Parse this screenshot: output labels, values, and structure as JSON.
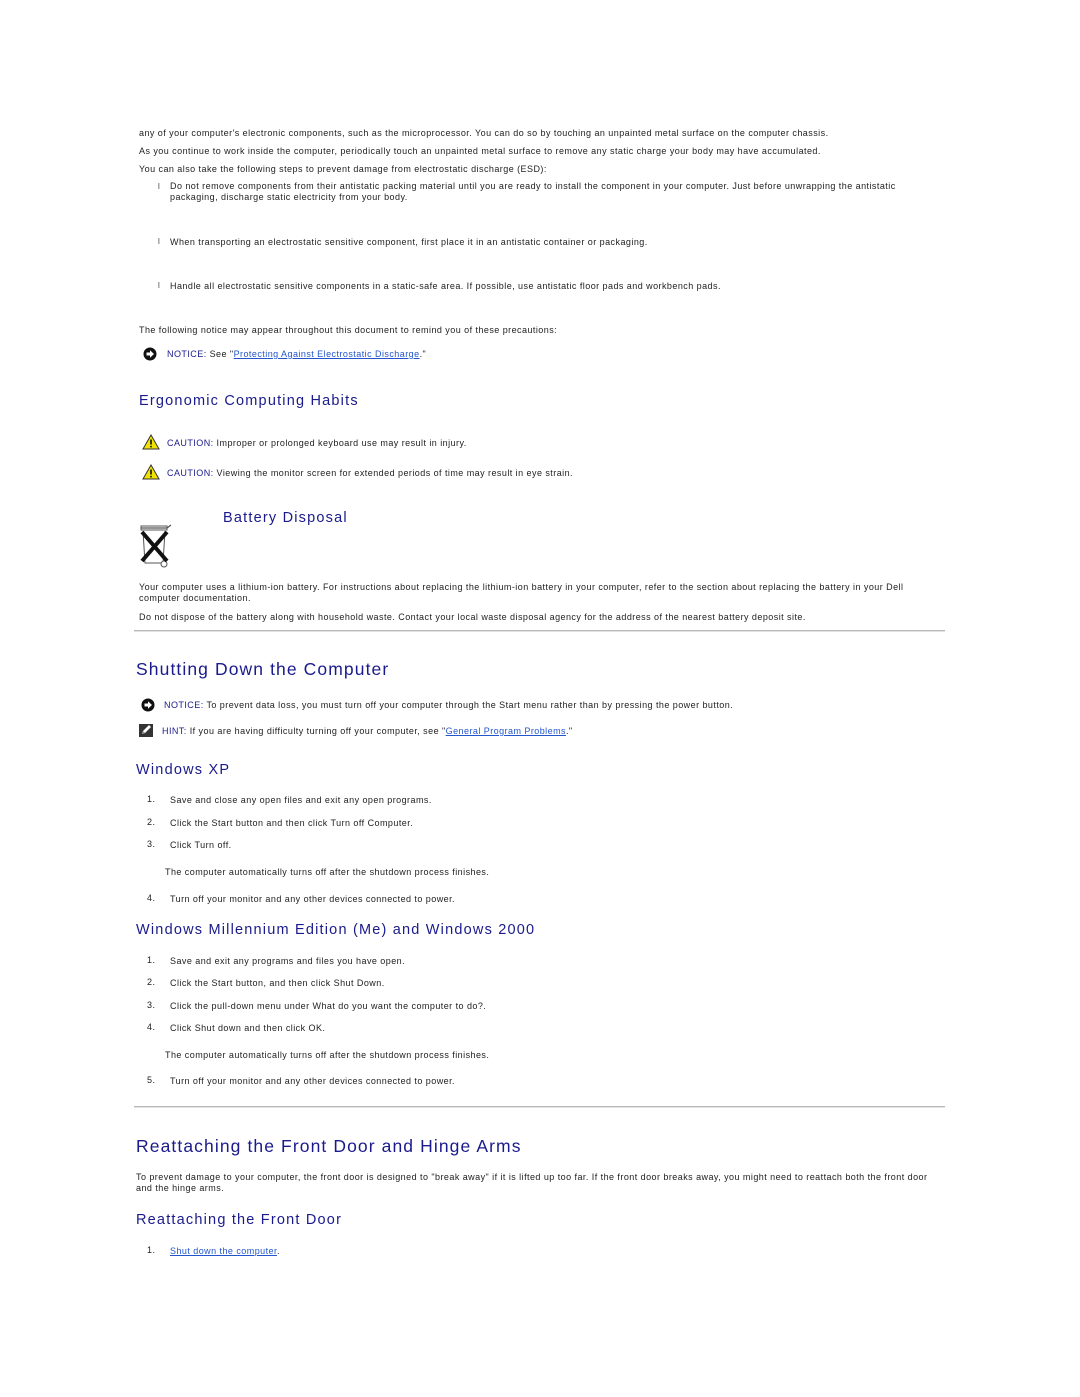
{
  "intro": {
    "line1": "any of your computer's electronic components, such as the microprocessor. You can do so by touching an unpainted metal surface on the computer chassis.",
    "line2": "As you continue to work inside the computer, periodically touch an unpainted metal surface to remove any static charge your body may have accumulated.",
    "line3": "You can also take the following steps to prevent damage from electrostatic discharge (ESD):",
    "bullets": [
      "Do not remove components from their antistatic packing material until you are ready to install the component in your computer. Just before unwrapping the antistatic packaging, discharge static electricity from your body.",
      "When transporting an electrostatic sensitive component, first place it in an antistatic container or packaging.",
      "Handle all electrostatic sensitive components in a static-safe area. If possible, use antistatic floor pads and workbench pads."
    ],
    "bullet_glyph": "l",
    "notice_intro": "The following notice may appear throughout this document to remind you of these precautions:",
    "notice": {
      "label": "NOTICE:",
      "pre": " See \"",
      "link": "Protecting Against Electrostatic Discharge",
      "post": ".\""
    }
  },
  "ergonomic": {
    "title": "Ergonomic Computing Habits",
    "cautions": [
      {
        "label": "CAUTION:",
        "text": " Improper or prolonged keyboard use may result in injury."
      },
      {
        "label": "CAUTION:",
        "text": " Viewing the monitor screen for extended periods of time may result in eye strain."
      }
    ]
  },
  "battery": {
    "title": "Battery Disposal",
    "para1": "Your computer uses a lithium-ion battery. For instructions about replacing the lithium-ion battery in your computer, refer to the section about replacing the battery in your Dell computer documentation.",
    "para2": "Do not dispose of the battery along with household waste. Contact your local waste disposal agency for the address of the nearest battery deposit site."
  },
  "shutdown": {
    "title": "Shutting Down the Computer",
    "notice": {
      "label": "NOTICE:",
      "text": " To prevent data loss, you must turn off your computer through the Start menu rather than by pressing the power button."
    },
    "hint": {
      "label": "HINT:",
      "pre": " If you are having difficulty turning off your computer, see \"",
      "link": "General Program Problems",
      "post": ".\""
    },
    "xp": {
      "title": "Windows XP",
      "steps": [
        {
          "num": "1.",
          "text": "Save and close any open files and exit any open programs."
        },
        {
          "num": "2.",
          "text": "Click the Start button and then click Turn off Computer."
        },
        {
          "num": "3.",
          "text": "Click Turn off."
        },
        {
          "num": "4.",
          "text": "Turn off your monitor and any other devices connected to power."
        }
      ],
      "note": "The computer automatically turns off after the shutdown process finishes."
    },
    "me2000": {
      "title": "Windows Millennium Edition (Me) and Windows 2000",
      "steps": [
        {
          "num": "1.",
          "text": "Save and exit any programs and files you have open."
        },
        {
          "num": "2.",
          "text": "Click the Start button, and then click Shut Down."
        },
        {
          "num": "3.",
          "text": "Click the pull-down menu under What do you want the computer to do?."
        },
        {
          "num": "4.",
          "text": "Click Shut down and then click OK."
        },
        {
          "num": "5.",
          "text": "Turn off your monitor and any other devices connected to power."
        }
      ],
      "note": "The computer automatically turns off after the shutdown process finishes."
    }
  },
  "front_door": {
    "title": "Reattaching the Front Door and Hinge Arms",
    "para": "To prevent damage to your computer, the front door is designed to \"break away\" if it is lifted up too far. If the front door breaks away, you might need to reattach both the front door and the hinge arms.",
    "sub_title": "Reattaching the Front Door",
    "steps": [
      {
        "num": "1.",
        "link": "Shut down the computer",
        "post": "."
      }
    ]
  },
  "colors": {
    "heading": "#1a1a8c",
    "link": "#2255cc",
    "caution_yellow": "#f2e200"
  }
}
